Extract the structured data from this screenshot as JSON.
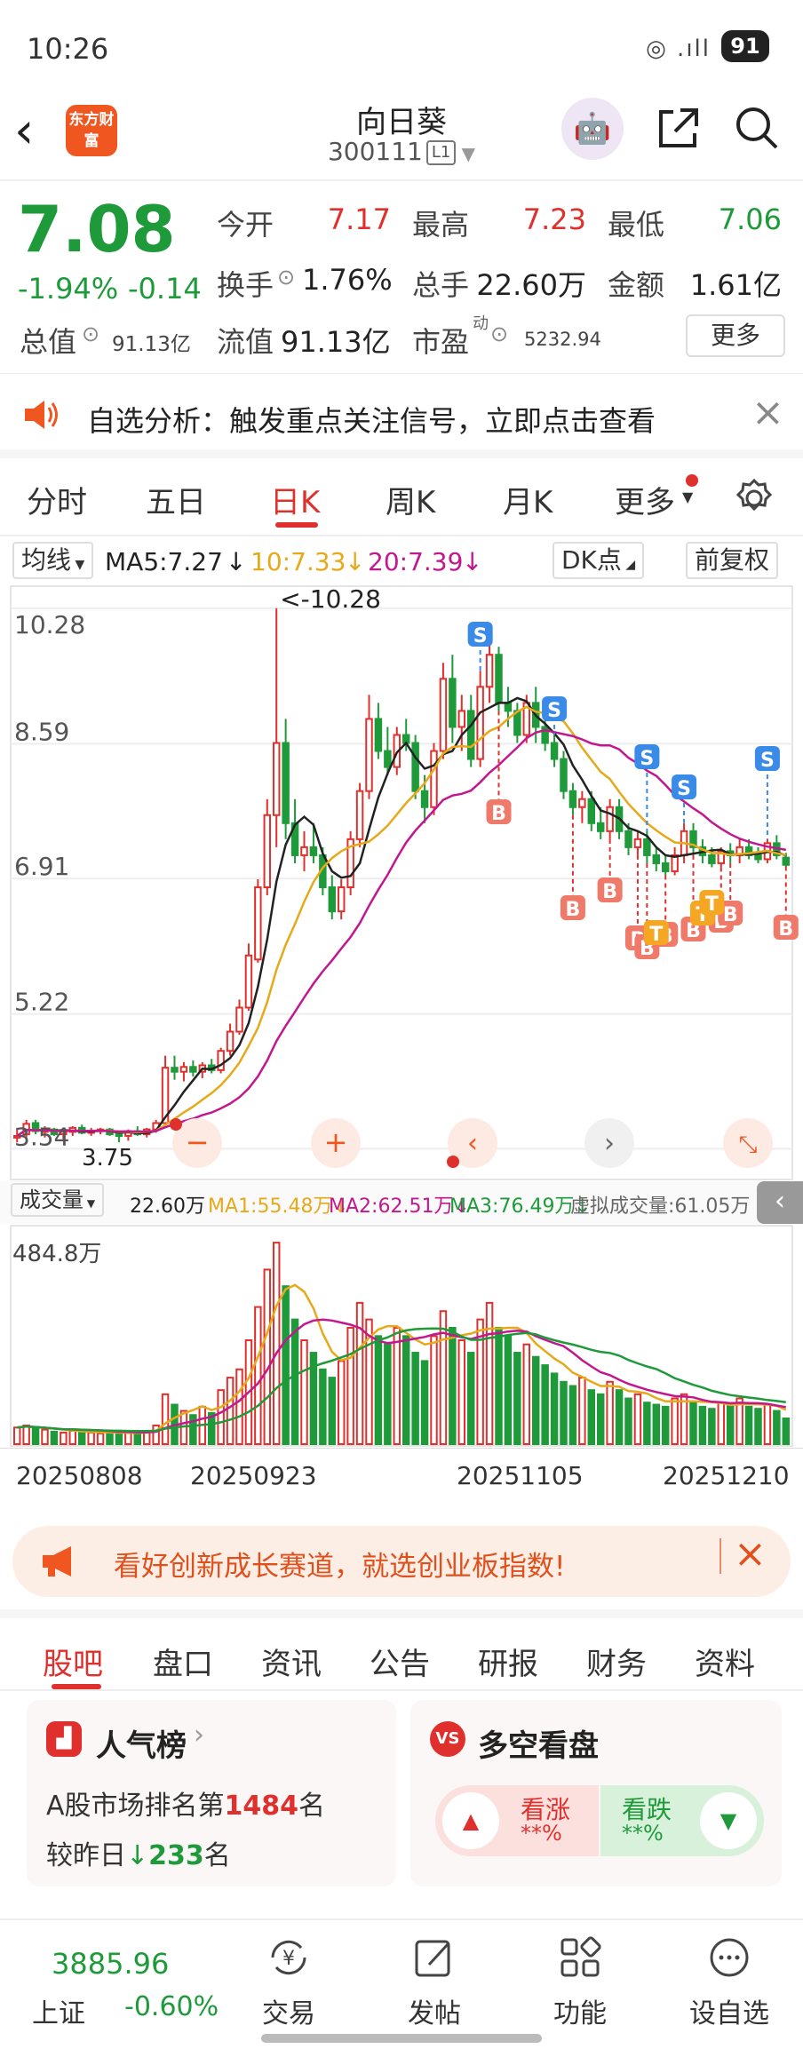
{
  "status": {
    "time": "10:26",
    "battery": "91"
  },
  "nav": {
    "title": "向日葵",
    "code": "300111",
    "level": "L1",
    "logo": "东方财富"
  },
  "quote": {
    "price": "7.08",
    "change_pct": "-1.94%",
    "change": "-0.14",
    "open_label": "今开",
    "open": "7.17",
    "high_label": "最高",
    "high": "7.23",
    "low_label": "最低",
    "low": "7.06",
    "turnover_label": "换手",
    "turnover": "1.76%",
    "volume_label": "总手",
    "volume": "22.60万",
    "amount_label": "金额",
    "amount": "1.61亿",
    "mcap_label": "总值",
    "mcap": "91.13亿",
    "float_label": "流值",
    "float": "91.13亿",
    "pe_label": "市盈",
    "pe_sup": "动",
    "pe": "5232.94",
    "more": "更多"
  },
  "notice": {
    "text": "自选分析：触发重点关注信号，立即点击查看"
  },
  "chart_tabs": [
    "分时",
    "五日",
    "日K",
    "周K",
    "月K",
    "更多"
  ],
  "ma_bar": {
    "select": "均线",
    "ma5": "MA5:7.27",
    "ma10": "10:7.33",
    "ma20": "20:7.39",
    "dk": "DK点",
    "adj": "前复权"
  },
  "colors": {
    "up": "#e0302d",
    "down": "#1f9a3a",
    "ma5": "#222222",
    "ma10": "#e6a91a",
    "ma20": "#c2188f",
    "accent": "#e0302d"
  },
  "chart_data": [
    {
      "type": "candlestick",
      "y_ticks": [
        "10.28",
        "8.59",
        "6.91",
        "5.22",
        "3.54"
      ],
      "annotations": [
        "<-10.28",
        "3.75"
      ],
      "signal_labels": [
        "S",
        "B",
        "T"
      ],
      "ohlc": [
        [
          3.7,
          3.8,
          3.62,
          3.7
        ],
        [
          3.72,
          3.9,
          3.66,
          3.85
        ],
        [
          3.86,
          3.9,
          3.72,
          3.76
        ],
        [
          3.75,
          3.82,
          3.68,
          3.78
        ],
        [
          3.78,
          3.8,
          3.7,
          3.72
        ],
        [
          3.72,
          3.78,
          3.66,
          3.75
        ],
        [
          3.75,
          3.82,
          3.7,
          3.8
        ],
        [
          3.8,
          3.84,
          3.72,
          3.74
        ],
        [
          3.74,
          3.8,
          3.7,
          3.76
        ],
        [
          3.76,
          3.8,
          3.72,
          3.78
        ],
        [
          3.78,
          3.8,
          3.7,
          3.72
        ],
        [
          3.72,
          3.76,
          3.62,
          3.7
        ],
        [
          3.7,
          3.78,
          3.64,
          3.76
        ],
        [
          3.76,
          3.82,
          3.7,
          3.72
        ],
        [
          3.72,
          3.8,
          3.68,
          3.78
        ],
        [
          3.78,
          3.9,
          3.74,
          3.86
        ],
        [
          3.86,
          4.7,
          3.84,
          4.55
        ],
        [
          4.55,
          4.7,
          4.4,
          4.5
        ],
        [
          4.5,
          4.62,
          4.38,
          4.56
        ],
        [
          4.56,
          4.64,
          4.44,
          4.5
        ],
        [
          4.5,
          4.62,
          4.42,
          4.58
        ],
        [
          4.58,
          4.66,
          4.48,
          4.52
        ],
        [
          4.52,
          4.8,
          4.48,
          4.76
        ],
        [
          4.76,
          5.1,
          4.7,
          5.0
        ],
        [
          5.0,
          5.4,
          4.96,
          5.3
        ],
        [
          5.3,
          6.1,
          5.26,
          5.95
        ],
        [
          5.9,
          6.9,
          5.86,
          6.8
        ],
        [
          6.8,
          7.9,
          6.7,
          7.7
        ],
        [
          7.7,
          10.28,
          7.3,
          8.6
        ],
        [
          8.6,
          8.9,
          7.4,
          7.6
        ],
        [
          7.6,
          7.9,
          7.1,
          7.2
        ],
        [
          7.2,
          7.5,
          7.0,
          7.3
        ],
        [
          7.3,
          7.6,
          7.1,
          7.2
        ],
        [
          7.2,
          7.3,
          6.7,
          6.8
        ],
        [
          6.8,
          6.95,
          6.4,
          6.5
        ],
        [
          6.5,
          6.9,
          6.4,
          6.8
        ],
        [
          6.8,
          7.5,
          6.7,
          7.4
        ],
        [
          7.4,
          8.1,
          7.3,
          8.0
        ],
        [
          8.0,
          9.2,
          7.9,
          8.9
        ],
        [
          8.9,
          9.1,
          8.4,
          8.5
        ],
        [
          8.5,
          8.8,
          8.2,
          8.3
        ],
        [
          8.3,
          8.8,
          8.2,
          8.7
        ],
        [
          8.7,
          8.9,
          8.5,
          8.6
        ],
        [
          8.6,
          8.7,
          7.9,
          8.0
        ],
        [
          8.0,
          8.2,
          7.6,
          7.8
        ],
        [
          7.8,
          8.6,
          7.7,
          8.5
        ],
        [
          8.5,
          9.6,
          8.4,
          9.4
        ],
        [
          9.4,
          9.7,
          8.6,
          8.8
        ],
        [
          8.8,
          9.2,
          8.5,
          9.0
        ],
        [
          9.0,
          9.2,
          8.3,
          8.4
        ],
        [
          8.4,
          9.5,
          8.3,
          9.3
        ],
        [
          9.3,
          9.9,
          9.1,
          9.7
        ],
        [
          9.7,
          9.8,
          9.0,
          9.1
        ],
        [
          9.1,
          9.3,
          8.8,
          9.0
        ],
        [
          9.0,
          9.1,
          8.6,
          8.7
        ],
        [
          8.7,
          9.2,
          8.6,
          9.1
        ],
        [
          9.1,
          9.3,
          8.6,
          8.8
        ],
        [
          8.8,
          9.0,
          8.5,
          8.6
        ],
        [
          8.6,
          8.7,
          8.3,
          8.4
        ],
        [
          8.4,
          8.5,
          7.9,
          8.0
        ],
        [
          8.0,
          8.1,
          7.7,
          7.8
        ],
        [
          7.8,
          8.0,
          7.6,
          7.9
        ],
        [
          7.9,
          8.0,
          7.5,
          7.6
        ],
        [
          7.6,
          7.8,
          7.4,
          7.5
        ],
        [
          7.5,
          7.9,
          7.4,
          7.8
        ],
        [
          7.8,
          7.9,
          7.4,
          7.5
        ],
        [
          7.5,
          7.6,
          7.2,
          7.3
        ],
        [
          7.3,
          7.5,
          7.2,
          7.4
        ],
        [
          7.4,
          7.5,
          7.1,
          7.2
        ],
        [
          7.2,
          7.3,
          7.0,
          7.1
        ],
        [
          7.1,
          7.2,
          6.95,
          7.0
        ],
        [
          7.0,
          7.3,
          6.95,
          7.2
        ],
        [
          7.2,
          7.6,
          7.1,
          7.5
        ],
        [
          7.5,
          7.6,
          7.2,
          7.3
        ],
        [
          7.3,
          7.4,
          7.1,
          7.2
        ],
        [
          7.2,
          7.3,
          7.05,
          7.1
        ],
        [
          7.1,
          7.3,
          7.05,
          7.25
        ],
        [
          7.25,
          7.35,
          7.1,
          7.2
        ],
        [
          7.2,
          7.4,
          7.1,
          7.3
        ],
        [
          7.3,
          7.4,
          7.15,
          7.2
        ],
        [
          7.2,
          7.3,
          7.1,
          7.15
        ],
        [
          7.15,
          7.4,
          7.1,
          7.35
        ],
        [
          7.35,
          7.45,
          7.15,
          7.2
        ],
        [
          7.17,
          7.23,
          7.06,
          7.08
        ]
      ]
    },
    {
      "type": "bar",
      "title": "成交量",
      "max_label": "484.8万",
      "values": [
        40,
        45,
        38,
        35,
        30,
        28,
        32,
        30,
        28,
        26,
        25,
        30,
        28,
        26,
        30,
        45,
        120,
        95,
        80,
        70,
        90,
        75,
        130,
        160,
        180,
        250,
        330,
        420,
        484.8,
        380,
        300,
        250,
        220,
        180,
        160,
        200,
        280,
        340,
        300,
        260,
        240,
        280,
        260,
        220,
        200,
        260,
        320,
        280,
        250,
        220,
        300,
        340,
        280,
        260,
        220,
        240,
        210,
        190,
        170,
        150,
        140,
        160,
        130,
        120,
        150,
        130,
        110,
        120,
        100,
        95,
        90,
        110,
        120,
        100,
        90,
        85,
        100,
        95,
        110,
        90,
        85,
        95,
        80,
        62
      ],
      "lines": {
        "MA1": "55.48万",
        "MA2": "62.51万",
        "MA3": "76.49万"
      },
      "current": "22.60万",
      "virtual": "虚拟成交量:61.05万",
      "x_labels": [
        "20250808",
        "20250923",
        "20251105",
        "20251210"
      ]
    }
  ],
  "banner": {
    "text": "看好创新成长赛道，就选创业板指数!"
  },
  "sub_tabs": [
    "股吧",
    "盘口",
    "资讯",
    "公告",
    "研报",
    "财务",
    "资料"
  ],
  "cards": {
    "rank_title": "人气榜",
    "rank_line1_pre": "A股市场排名第",
    "rank_num": "1484",
    "rank_line1_post": "名",
    "rank_line2_pre": "较昨日",
    "rank_delta": "233",
    "rank_line2_post": "名",
    "ls_title": "多空看盘",
    "up_label": "看涨",
    "up_val": "**%",
    "down_label": "看跌",
    "down_val": "**%"
  },
  "bottom": {
    "index_value": "3885.96",
    "index_name": "上证",
    "index_chg": "-0.60%",
    "items": [
      "交易",
      "发帖",
      "功能",
      "设自选"
    ]
  }
}
